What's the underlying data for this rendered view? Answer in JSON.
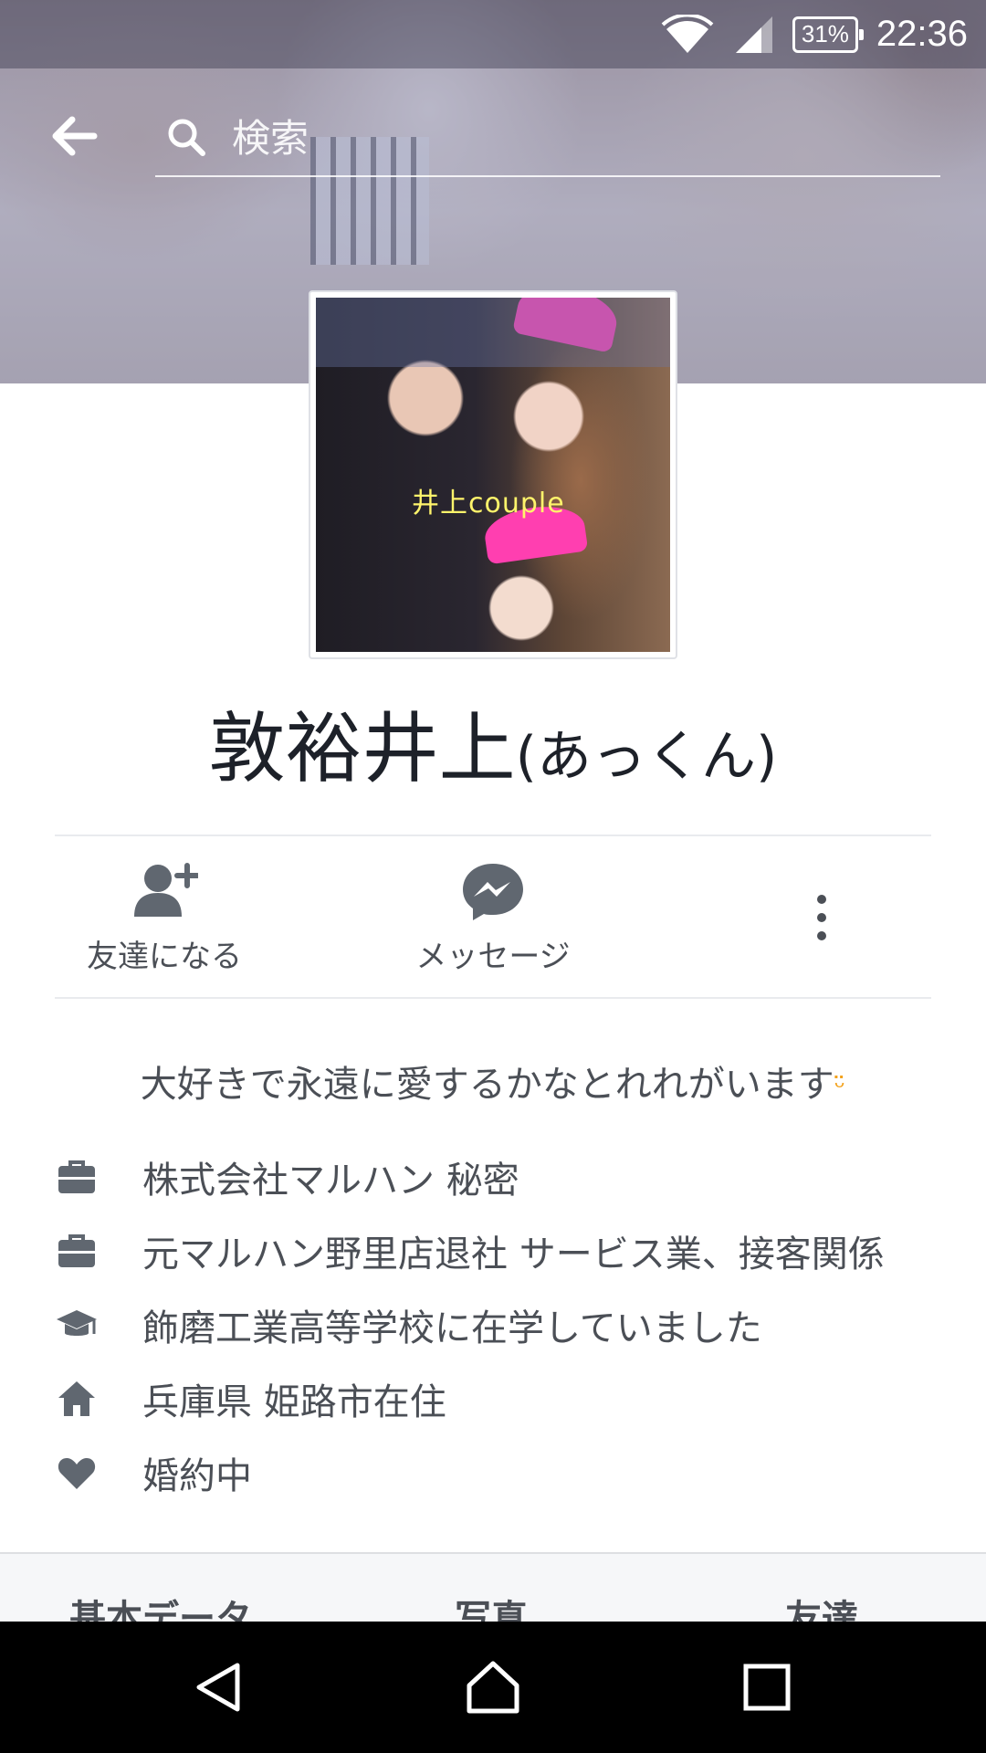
{
  "status_bar": {
    "battery": "31%",
    "time": "22:36"
  },
  "search": {
    "placeholder": "検索"
  },
  "avatar": {
    "caption": "井上couple"
  },
  "profile": {
    "name": "敦裕井上",
    "nickname": "(あっくん)"
  },
  "actions": {
    "add_friend": "友達になる",
    "message": "メッセージ"
  },
  "bio": {
    "text": "大好きで永遠に愛するかなとれれがいます",
    "emoji": "ᵕ̈"
  },
  "info": [
    {
      "icon": "briefcase-icon",
      "text": "株式会社マルハン 秘密"
    },
    {
      "icon": "briefcase-icon",
      "text": "元マルハン野里店退社 サービス業、接客関係"
    },
    {
      "icon": "graduation-cap-icon",
      "text": "飾磨工業高等学校に在学していました"
    },
    {
      "icon": "home-icon",
      "text": "兵庫県 姫路市在住"
    },
    {
      "icon": "heart-icon",
      "text": "婚約中"
    }
  ],
  "tabs": [
    "基本データ",
    "写真",
    "友達"
  ],
  "colors": {
    "icon_gray": "#606770",
    "text_gray": "#4b4f56",
    "bio_emoji": "#f3a21c",
    "cover_tint": "#6c78aa"
  }
}
